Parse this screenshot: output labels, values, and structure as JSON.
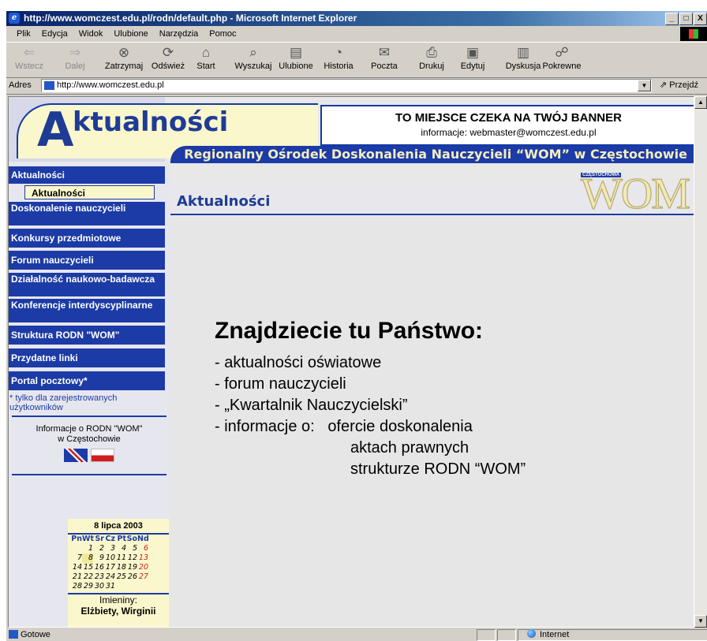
{
  "window": {
    "title": "http://www.womczest.edu.pl/rodn/default.php - Microsoft Internet Explorer",
    "controls": [
      "_",
      "□",
      "X"
    ]
  },
  "menu": [
    "Plik",
    "Edycja",
    "Widok",
    "Ulubione",
    "Narzędzia",
    "Pomoc"
  ],
  "toolbar": {
    "back": "Wstecz",
    "forward": "Dalej",
    "stop": "Zatrzymaj",
    "refresh": "Odśwież",
    "home": "Start",
    "search": "Wyszukaj",
    "favorites": "Ulubione",
    "history": "Historia",
    "mail": "Poczta",
    "print": "Drukuj",
    "edit": "Edytuj",
    "discuss": "Dyskusja",
    "related": "Pokrewne"
  },
  "address": {
    "label": "Adres",
    "value": "http://www.womczest.edu.pl",
    "go": "Przejdź"
  },
  "site": {
    "logo_letter": "A",
    "logo_word": "ktualności",
    "banner_title": "TO MIEJSCE CZEKA NA TWÓJ BANNER",
    "banner_info": "informacje: webmaster@womczest.edu.pl",
    "org_name": "Regionalny Ośrodek Doskonalenia Nauczycieli “WOM” w Częstochowie",
    "section_title": "Aktualności",
    "wom_logo_tag": "CZĘSTOCHOWA",
    "wom_logo_text": "WOM"
  },
  "nav": {
    "items": [
      "Aktualności",
      "Doskonalenie nauczycieli",
      "Konkursy przedmiotowe",
      "Forum nauczycieli",
      "Działalność naukowo-badawcza",
      "Konferencje interdyscyplinarne",
      "Struktura RODN \"WOM\"",
      "Przydatne linki",
      "Portal pocztowy*"
    ],
    "sub_active": "Aktualności",
    "note": "* tylko dla zarejestrowanych użytkowników",
    "info_line1": "Informacje o RODN \"WOM\"",
    "info_line2": "w Częstochowie"
  },
  "calendar": {
    "header": "8 lipca 2003",
    "day_names": [
      "Pn",
      "Wt",
      "Sr",
      "Cz",
      "Pt",
      "So",
      "Nd"
    ],
    "weeks": [
      [
        "",
        "1",
        "2",
        "3",
        "4",
        "5",
        "6"
      ],
      [
        "7",
        "8",
        "9",
        "10",
        "11",
        "12",
        "13"
      ],
      [
        "14",
        "15",
        "16",
        "17",
        "18",
        "19",
        "20"
      ],
      [
        "21",
        "22",
        "23",
        "24",
        "25",
        "26",
        "27"
      ],
      [
        "28",
        "29",
        "30",
        "31",
        "",
        "",
        ""
      ]
    ],
    "today": "8",
    "name_days_label": "Imieniny:",
    "name_days": "Elżbiety, Wirginii"
  },
  "content": {
    "heading": "Znajdziecie tu Państwo:",
    "lines": [
      "- aktualności oświatowe",
      "- forum nauczycieli",
      "- „Kwartalnik Nauczycielski”",
      "- informacje o:   ofercie doskonalenia",
      "aktach prawnych",
      "strukturze RODN “WOM”"
    ]
  },
  "status": {
    "text": "Gotowe",
    "zone": "Internet"
  }
}
